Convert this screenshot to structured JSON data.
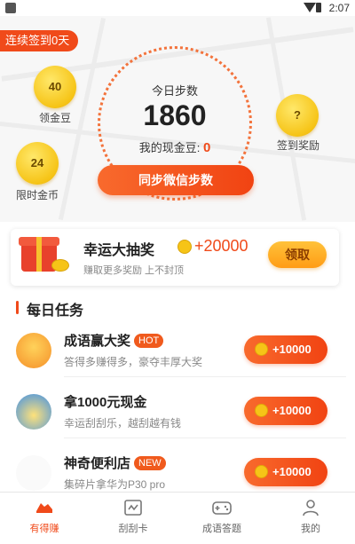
{
  "status_bar": {
    "time": "2:07"
  },
  "hero": {
    "streak_label": "连续签到0天",
    "coins": [
      {
        "value": "40",
        "label": "领金豆"
      },
      {
        "value": "24",
        "label": "限时金币"
      },
      {
        "value": "?",
        "label": "签到奖励"
      }
    ],
    "dial": {
      "title": "今日步数",
      "steps": "1860",
      "cash_label": "我的现金豆:",
      "cash_value": "0"
    },
    "sync_button": "同步微信步数"
  },
  "lottery": {
    "title": "幸运大抽奖",
    "amount": "+20000",
    "subtitle": "赚取更多奖励 上不封顶",
    "claim_label": "领取"
  },
  "daily_tasks": {
    "title": "每日任务",
    "items": [
      {
        "title": "成语赢大奖",
        "tag": "HOT",
        "desc": "答得多赚得多，豪夺丰厚大奖",
        "reward": "+10000"
      },
      {
        "title": "拿1000元现金",
        "tag": "",
        "desc": "幸运刮刮乐，越刮越有钱",
        "reward": "+10000"
      },
      {
        "title": "神奇便利店",
        "tag": "NEW",
        "desc": "集碎片拿华为P30 pro",
        "reward": "+10000"
      }
    ]
  },
  "tabbar": {
    "tabs": [
      {
        "label": "有得赚",
        "icon": "shoe-icon",
        "active": true
      },
      {
        "label": "刮刮卡",
        "icon": "scratch-card-icon",
        "active": false
      },
      {
        "label": "成语答题",
        "icon": "gamepad-icon",
        "active": false
      },
      {
        "label": "我的",
        "icon": "person-icon",
        "active": false
      }
    ]
  },
  "colors": {
    "accent": "#f04a1a",
    "gold": "#f6c417",
    "button_orange": "#ff9c15"
  }
}
